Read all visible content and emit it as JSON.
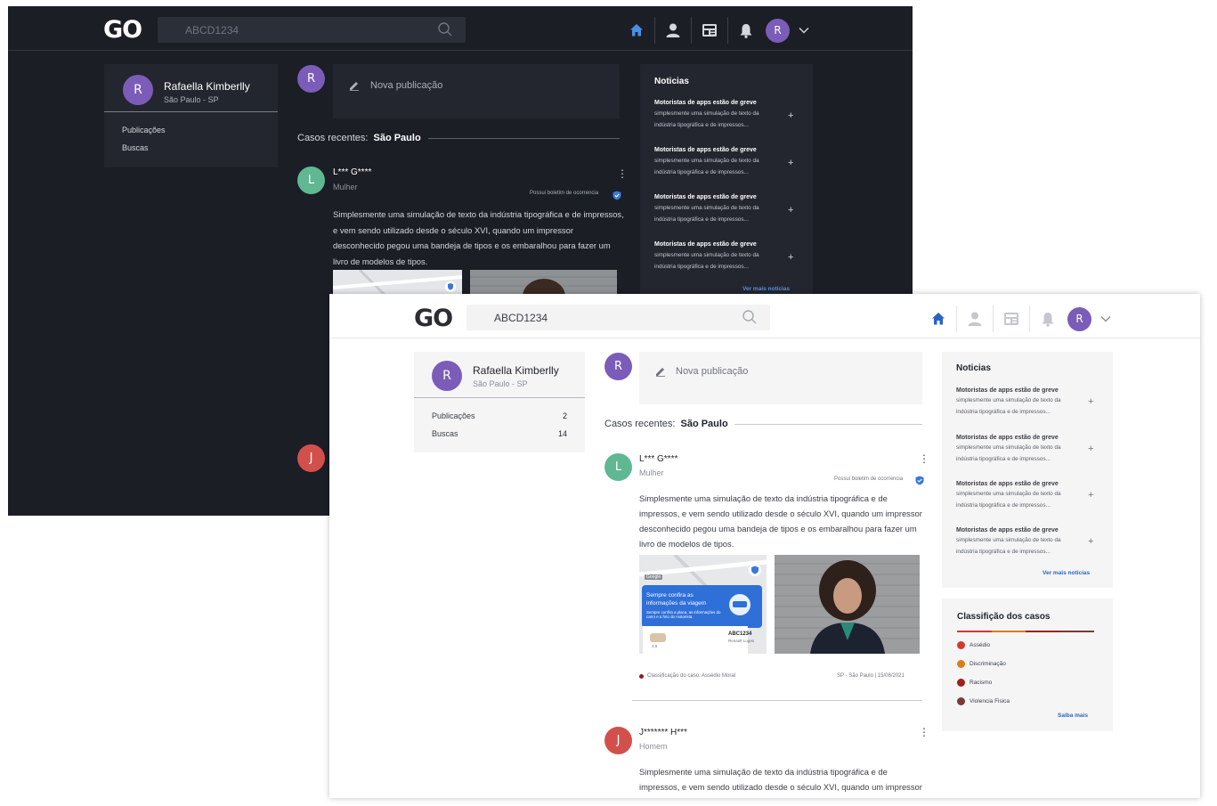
{
  "app": {
    "logo": "GO"
  },
  "search": {
    "value": "ABCD1234"
  },
  "user": {
    "initial": "R",
    "name": "Rafaella Kimberlly",
    "location": "São Paulo - SP"
  },
  "sidebar": {
    "items": [
      {
        "label": "Publicações",
        "count": "2"
      },
      {
        "label": "Buscas",
        "count": "14"
      }
    ]
  },
  "new_post": {
    "label": "Nova publicação"
  },
  "recent": {
    "label": "Casos recentes:",
    "city": "São Paulo"
  },
  "cases": [
    {
      "initial": "L",
      "name": "L*** G****",
      "gender": "Mulher",
      "boletim": "Possui boletim de ocorrencia",
      "text": "Simplesmente uma simulação de texto da indústria tipográfica e de impressos, e vem sendo utilizado desde o século XVI, quando um impressor desconhecido pegou uma bandeja de tipos e os embaralhou para fazer um livro de modelos de tipos.",
      "map_card": {
        "brand": "Google",
        "title": "Sempre confira as informações da viagem",
        "subtitle": "Sempre confira a placa, as informações do carro e a foto do motorista.",
        "plate": "ABC1234",
        "car": "Renault Logan",
        "rating": "4.8"
      },
      "classification": "Classificação do caso: Assédio Moral",
      "place_date": "SP - São Paulo | 15/08/2021"
    },
    {
      "initial": "J",
      "name": "J******* H***",
      "gender": "Homem",
      "text": "Simplesmente uma simulação de texto da indústria tipográfica e de impressos, e vem sendo utilizado desde o século XVI, quando um impressor"
    }
  ],
  "news": {
    "title": "Noticias",
    "items": [
      {
        "headline": "Motoristas de apps estão de greve",
        "body": "simplesmente uma simulação de texto da indústria tipográfica e de impressos..."
      },
      {
        "headline": "Motoristas de apps estão de greve",
        "body": "simplesmente uma simulação de texto da indústria tipográfica e de impressos..."
      },
      {
        "headline": "Motoristas de apps estão de greve",
        "body": "simplesmente uma simulação de texto da indústria tipográfica e de impressos..."
      },
      {
        "headline": "Motoristas de apps estão de greve",
        "body": "simplesmente uma simulação de texto da indústria tipográfica e de impressos..."
      }
    ],
    "more": "Ver mais noticias"
  },
  "classification": {
    "title": "Classifição dos casos",
    "items": [
      {
        "label": "Assédio",
        "color": "#d23a2e"
      },
      {
        "label": "Discriminação",
        "color": "#e07a1c"
      },
      {
        "label": "Racismo",
        "color": "#a0201c"
      },
      {
        "label": "Violencia Fisica",
        "color": "#7a3a34"
      }
    ],
    "more": "Saiba mais"
  },
  "colors": {
    "accent": "#2a64c2",
    "home_icon": "#2a64c2",
    "dark_bg": "#1b1e25",
    "avatar": "#7b5cb8"
  },
  "icons": [
    "search-icon",
    "home-icon",
    "person-icon",
    "news-icon",
    "bell-icon",
    "chevron-down-icon",
    "pencil-icon",
    "shield-check-icon",
    "more-vert-icon",
    "plus-icon"
  ]
}
